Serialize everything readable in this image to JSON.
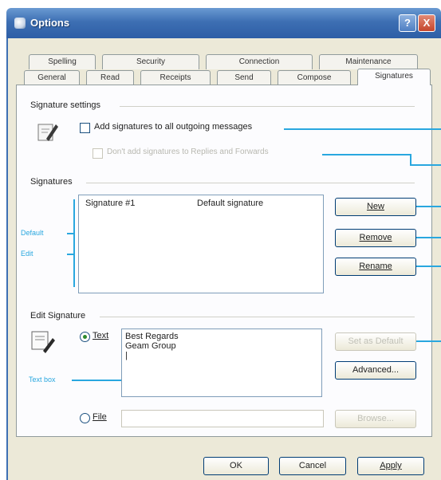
{
  "window": {
    "title": "Options"
  },
  "title_buttons": {
    "help": "?",
    "close": "X"
  },
  "tabs_row1": [
    "Spelling",
    "Security",
    "Connection",
    "Maintenance"
  ],
  "tabs_row2": [
    "General",
    "Read",
    "Receipts",
    "Send",
    "Compose",
    "Signatures"
  ],
  "signature_settings": {
    "label": "Signature settings",
    "add_checkbox_label": "Add signatures to all outgoing messages",
    "dont_add_label": "Don't add signatures to Replies and Forwards"
  },
  "signatures": {
    "label": "Signatures",
    "items": [
      {
        "name": "Signature #1",
        "status": "Default signature"
      }
    ],
    "buttons": {
      "new": "New",
      "remove": "Remove",
      "rename": "Rename"
    }
  },
  "edit_signature": {
    "label": "Edit Signature",
    "text_option": "Text",
    "text_value": "Best Regards\nGeam Group\n|",
    "file_option": "File",
    "file_value": "",
    "set_default": "Set as Default",
    "advanced": "Advanced...",
    "browse": "Browse..."
  },
  "footer_buttons": {
    "ok": "OK",
    "cancel": "Cancel",
    "apply": "Apply"
  },
  "callouts": {
    "default": "Default",
    "edit": "Edit",
    "text_box": "Text box"
  },
  "colors": {
    "callout": "#29a7df",
    "titlebar": "#3d6fb3",
    "dialog": "#ece9d8"
  }
}
